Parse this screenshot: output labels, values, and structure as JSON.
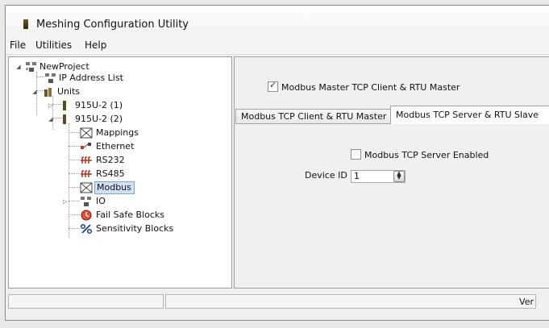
{
  "window": {
    "title": "Meshing Configuration Utility"
  },
  "menu": [
    "File",
    "Utilities",
    "Help"
  ],
  "tree": {
    "root": "NewProject",
    "ip_list": "IP Address List",
    "units": "Units",
    "unit1": "915U-2 (1)",
    "unit2": "915U-2 (2)",
    "mappings": "Mappings",
    "ethernet": "Ethernet",
    "rs232": "RS232",
    "rs485": "RS485",
    "modbus": "Modbus",
    "io": "IO",
    "failsafe": "Fail Safe Blocks",
    "sensitivity": "Sensitivity Blocks"
  },
  "right": {
    "master_checkbox": "Modbus Master TCP Client & RTU Master",
    "master_checked": true,
    "tabs": [
      "Modbus TCP Client & RTU Master",
      "Modbus TCP Server & RTU Slave"
    ],
    "active_tab": 1,
    "server_checkbox": "Modbus TCP Server Enabled",
    "server_checked": false,
    "device_id_label": "Device ID",
    "device_id_value": "1"
  },
  "status": {
    "version_text": "Ver"
  },
  "colors": {
    "selection": "#cfe1f5",
    "selection_border": "#7da2ce"
  }
}
